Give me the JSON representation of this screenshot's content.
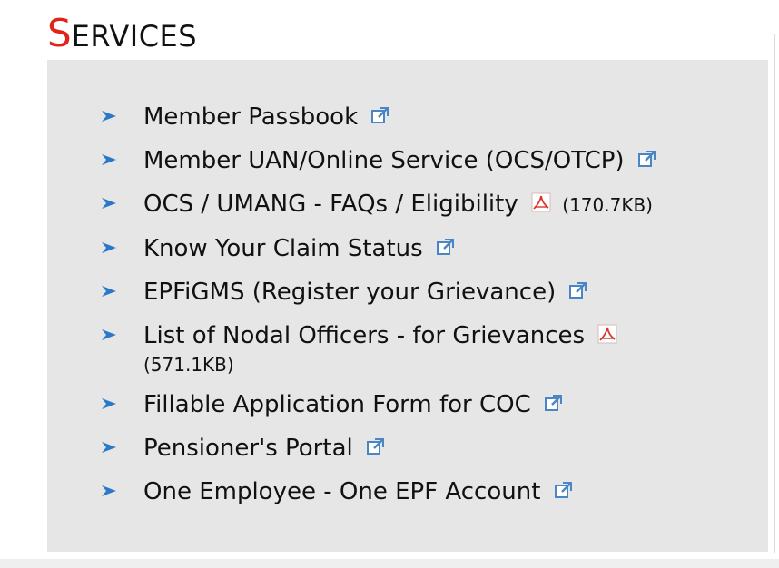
{
  "section": {
    "title_first_letter": "S",
    "title_rest": "ERVICES"
  },
  "services": {
    "items": [
      {
        "label": "Member Passbook",
        "icon": "external-link-icon"
      },
      {
        "label": "Member UAN/Online Service (OCS/OTCP)",
        "icon": "external-link-icon"
      },
      {
        "label": "OCS / UMANG - FAQs / Eligibility",
        "icon": "pdf-icon",
        "size": "(170.7KB)"
      },
      {
        "label": "Know Your Claim Status",
        "icon": "external-link-icon"
      },
      {
        "label": "EPFiGMS (Register your Grievance)",
        "icon": "external-link-icon"
      },
      {
        "label": "List of Nodal Officers - for Grievances",
        "icon": "pdf-icon",
        "size": "(571.1KB)"
      },
      {
        "label": "Fillable Application Form for COC",
        "icon": "external-link-icon"
      },
      {
        "label": "Pensioner's Portal",
        "icon": "external-link-icon"
      },
      {
        "label": "One Employee - One EPF Account",
        "icon": "external-link-icon"
      }
    ]
  },
  "colors": {
    "title_accent": "#e2231a",
    "panel_background": "#e6e6e6",
    "bullet_blue": "#2a78c8",
    "pdf_red": "#d9352b"
  }
}
